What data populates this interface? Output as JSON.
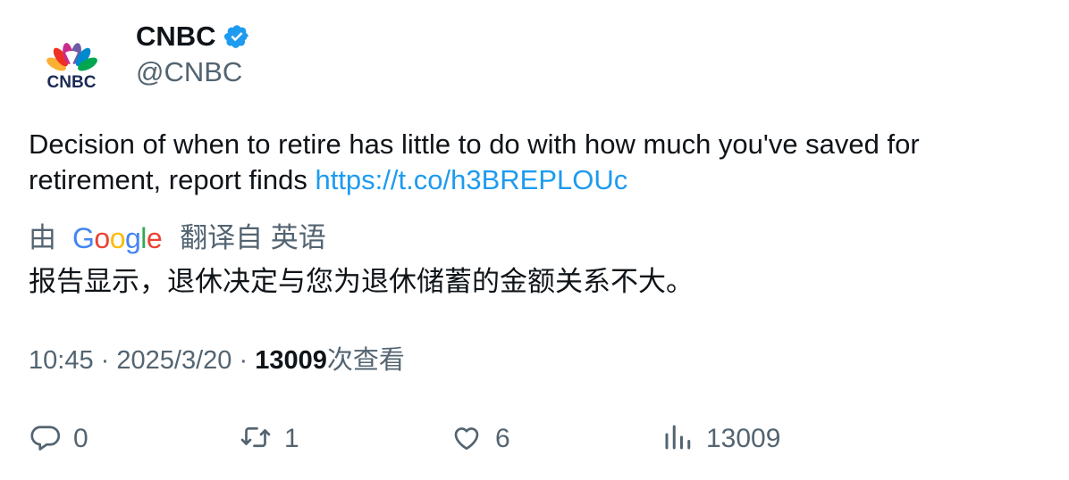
{
  "author": {
    "display_name": "CNBC",
    "handle": "@CNBC",
    "verified_icon": "verified-badge-icon",
    "avatar_logo_text": "CNBC"
  },
  "tweet": {
    "text": "Decision of when to retire has little to do with how much you've saved for retirement, report finds ",
    "link": "https://t.co/h3BREPLOUc"
  },
  "translation": {
    "prefix": "由",
    "provider_logo": "Google",
    "suffix": "翻译自 英语",
    "text": "报告显示，退休决定与您为退休储蓄的金额关系不大。"
  },
  "meta": {
    "time": "10:45",
    "separator": "·",
    "date": "2025/3/20",
    "views_count": "13009",
    "views_label": "次查看"
  },
  "actions": {
    "reply_count": "0",
    "retweet_count": "1",
    "like_count": "6",
    "views_count": "13009"
  },
  "colors": {
    "link": "#1d9bf0",
    "secondary_text": "#536471",
    "primary_text": "#0f1419",
    "verified": "#1d9bf0"
  }
}
